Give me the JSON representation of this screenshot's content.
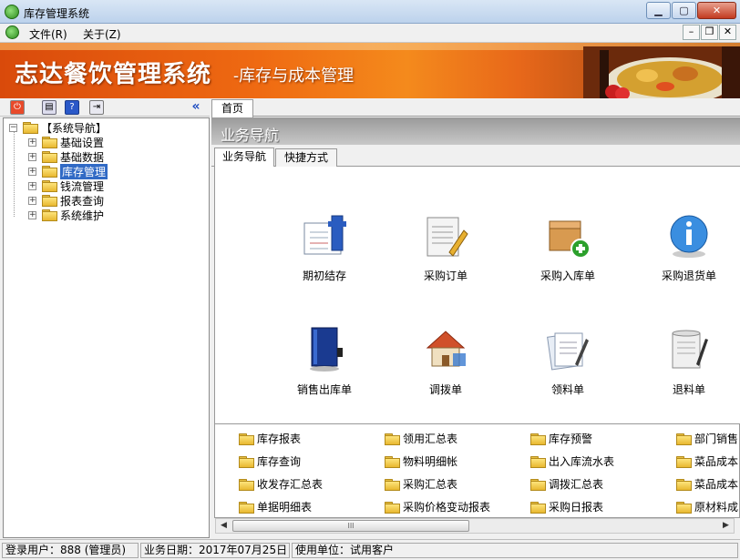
{
  "window": {
    "title": "库存管理系统",
    "minimize": "▁",
    "maximize": "▢",
    "close": "✕"
  },
  "menu": {
    "items": [
      "文件(R)",
      "关于(Z)"
    ],
    "mdi": [
      "–",
      "❐",
      "✕"
    ]
  },
  "banner": {
    "title": "志达餐饮管理系统",
    "subtitle": "-库存与成本管理"
  },
  "tree": {
    "root": "【系统导航】",
    "items": [
      "基础设置",
      "基础数据",
      "库存管理",
      "钱流管理",
      "报表查询",
      "系统维护"
    ],
    "selected_index": 2
  },
  "tabs": {
    "home": "首页"
  },
  "nav_header": "业务导航",
  "subtabs": [
    "业务导航",
    "快捷方式"
  ],
  "tiles": [
    "期初结存",
    "采购订单",
    "采购入库单",
    "采购退货单",
    "销售出库单",
    "调拨单",
    "领料单",
    "退料单"
  ],
  "reports": [
    [
      "库存报表",
      "领用汇总表",
      "库存预警",
      "部门销售"
    ],
    [
      "库存查询",
      "物料明细帐",
      "出入库流水表",
      "菜品成本"
    ],
    [
      "收发存汇总表",
      "采购汇总表",
      "调拨汇总表",
      "菜品成本"
    ],
    [
      "单据明细表",
      "采购价格变动报表",
      "采购日报表",
      "原材料成"
    ]
  ],
  "scrollbar": {
    "left": "◀",
    "right": "▶",
    "grip": "III"
  },
  "status": {
    "user": "登录用户：888 (管理员)",
    "date": "业务日期：2017年07月25日",
    "unit": "使用单位：试用客户"
  }
}
